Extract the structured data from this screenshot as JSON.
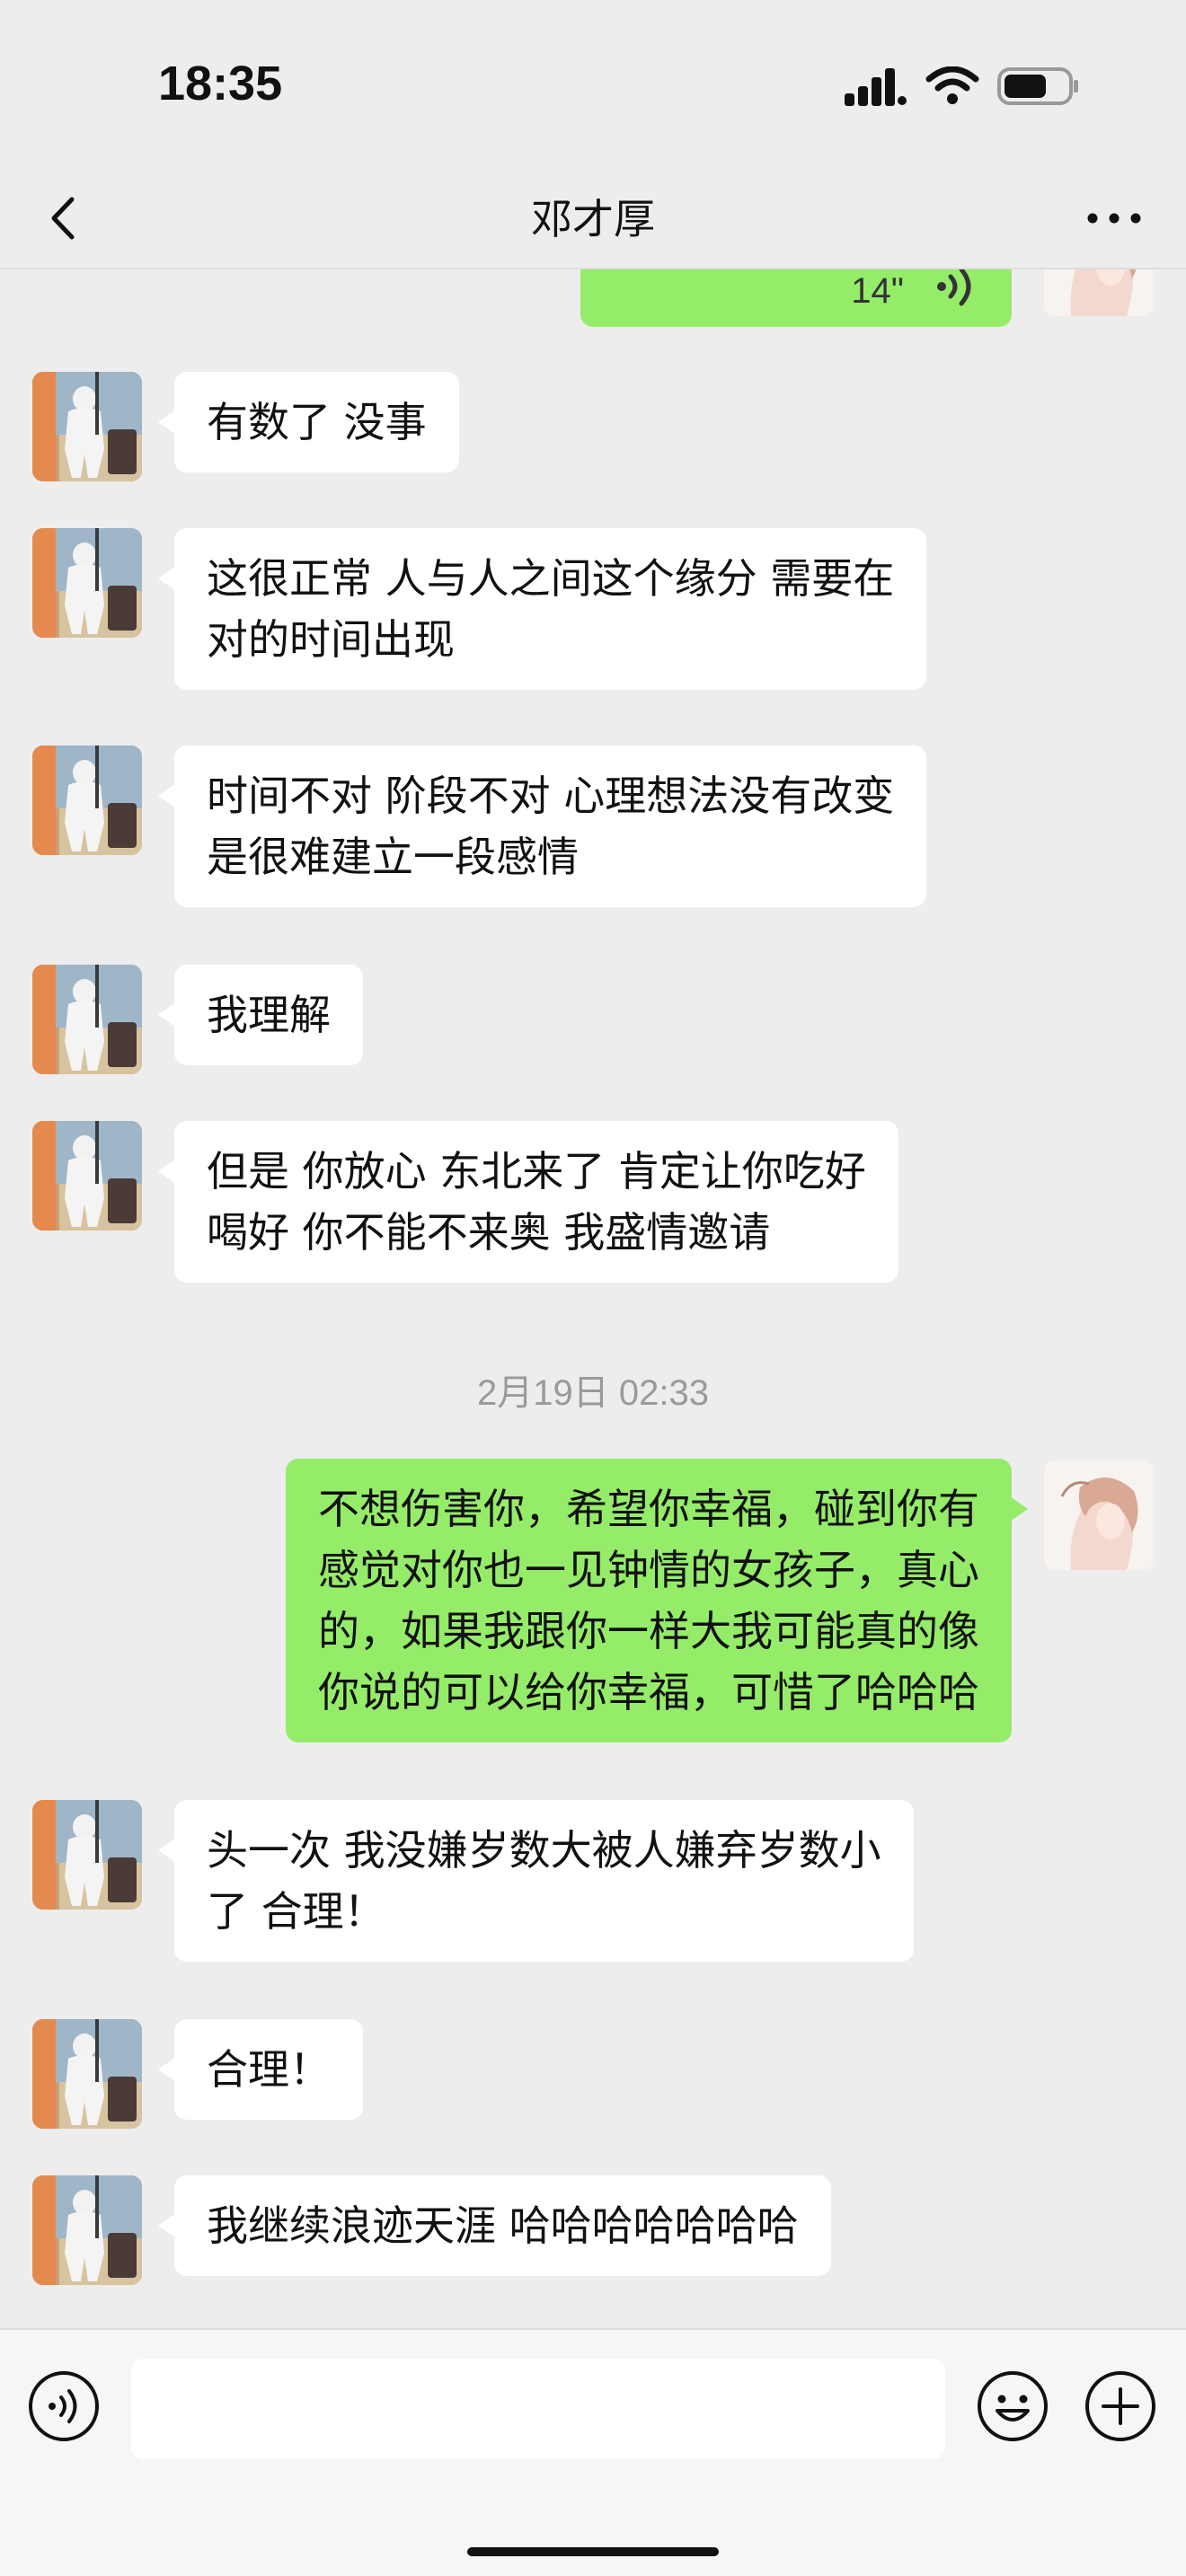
{
  "status_bar": {
    "time": "18:35"
  },
  "header": {
    "title": "邓才厚",
    "back_icon": "chevron-left-icon",
    "more_icon": "more-dots-icon"
  },
  "chat": {
    "voice_message": {
      "duration": "14\""
    },
    "messages": [
      {
        "side": "left",
        "lines": [
          "有数了 没事"
        ]
      },
      {
        "side": "left",
        "lines": [
          "这很正常 人与人之间这个缘分 需要在",
          "对的时间出现"
        ]
      },
      {
        "side": "left",
        "lines": [
          "时间不对 阶段不对 心理想法没有改变",
          "是很难建立一段感情"
        ]
      },
      {
        "side": "left",
        "lines": [
          "我理解"
        ]
      },
      {
        "side": "left",
        "lines": [
          "但是 你放心 东北来了 肯定让你吃好",
          "喝好 你不能不来奥 我盛情邀请"
        ]
      },
      {
        "side": "right",
        "lines": [
          "不想伤害你，希望你幸福，碰到你有",
          "感觉对你也一见钟情的女孩子，真心",
          "的，如果我跟你一样大我可能真的像",
          "你说的可以给你幸福，可惜了哈哈哈"
        ]
      },
      {
        "side": "left",
        "lines": [
          "头一次 我没嫌岁数大被人嫌弃岁数小",
          "了 合理！"
        ]
      },
      {
        "side": "left",
        "lines": [
          "合理！"
        ]
      },
      {
        "side": "left",
        "lines": [
          "我继续浪迹天涯 哈哈哈哈哈哈哈"
        ]
      }
    ],
    "timestamp": "2月19日 02:33"
  },
  "input_bar": {
    "placeholder": "",
    "voice_icon": "voice-icon",
    "emoji_icon": "emoji-icon",
    "plus_icon": "plus-icon"
  },
  "colors": {
    "background": "#ededed",
    "sent_bubble": "#95ec69",
    "received_bubble": "#ffffff"
  }
}
